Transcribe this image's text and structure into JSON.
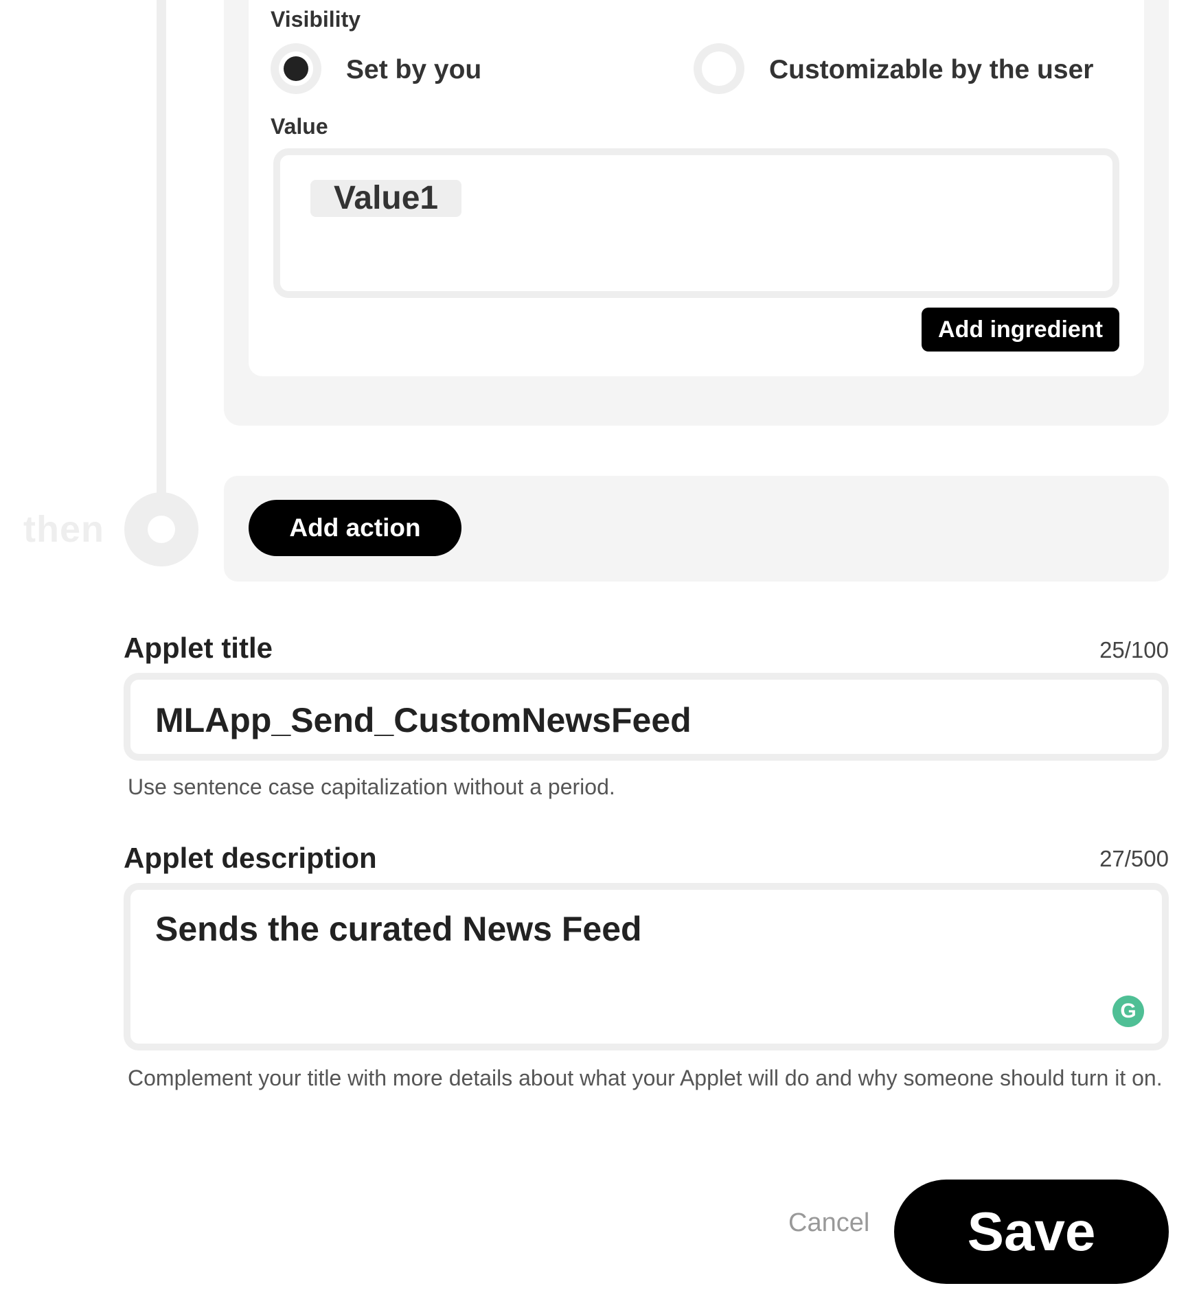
{
  "filter_field": {
    "visibility_label": "Visibility",
    "options": [
      {
        "label": "Set by you",
        "selected": true
      },
      {
        "label": "Customizable by the user",
        "selected": false
      }
    ],
    "value_label": "Value",
    "value_chip": "Value1",
    "add_ingredient_label": "Add ingredient"
  },
  "timeline": {
    "then_label": "then",
    "add_action_label": "Add action"
  },
  "applet_title": {
    "label": "Applet title",
    "counter": "25/100",
    "value": "MLApp_Send_CustomNewsFeed",
    "helper": "Use sentence case capitalization without a period."
  },
  "applet_description": {
    "label": "Applet description",
    "counter": "27/500",
    "value": "Sends the curated News Feed",
    "helper": "Complement your title with more details about what your Applet will do and why someone should turn it on.",
    "grammarly_glyph": "G"
  },
  "footer": {
    "cancel_label": "Cancel",
    "save_label": "Save"
  },
  "colors": {
    "accent": "#000000",
    "panel": "#f4f4f4",
    "border": "#eeeeee",
    "grammarly": "#4fbf95"
  }
}
